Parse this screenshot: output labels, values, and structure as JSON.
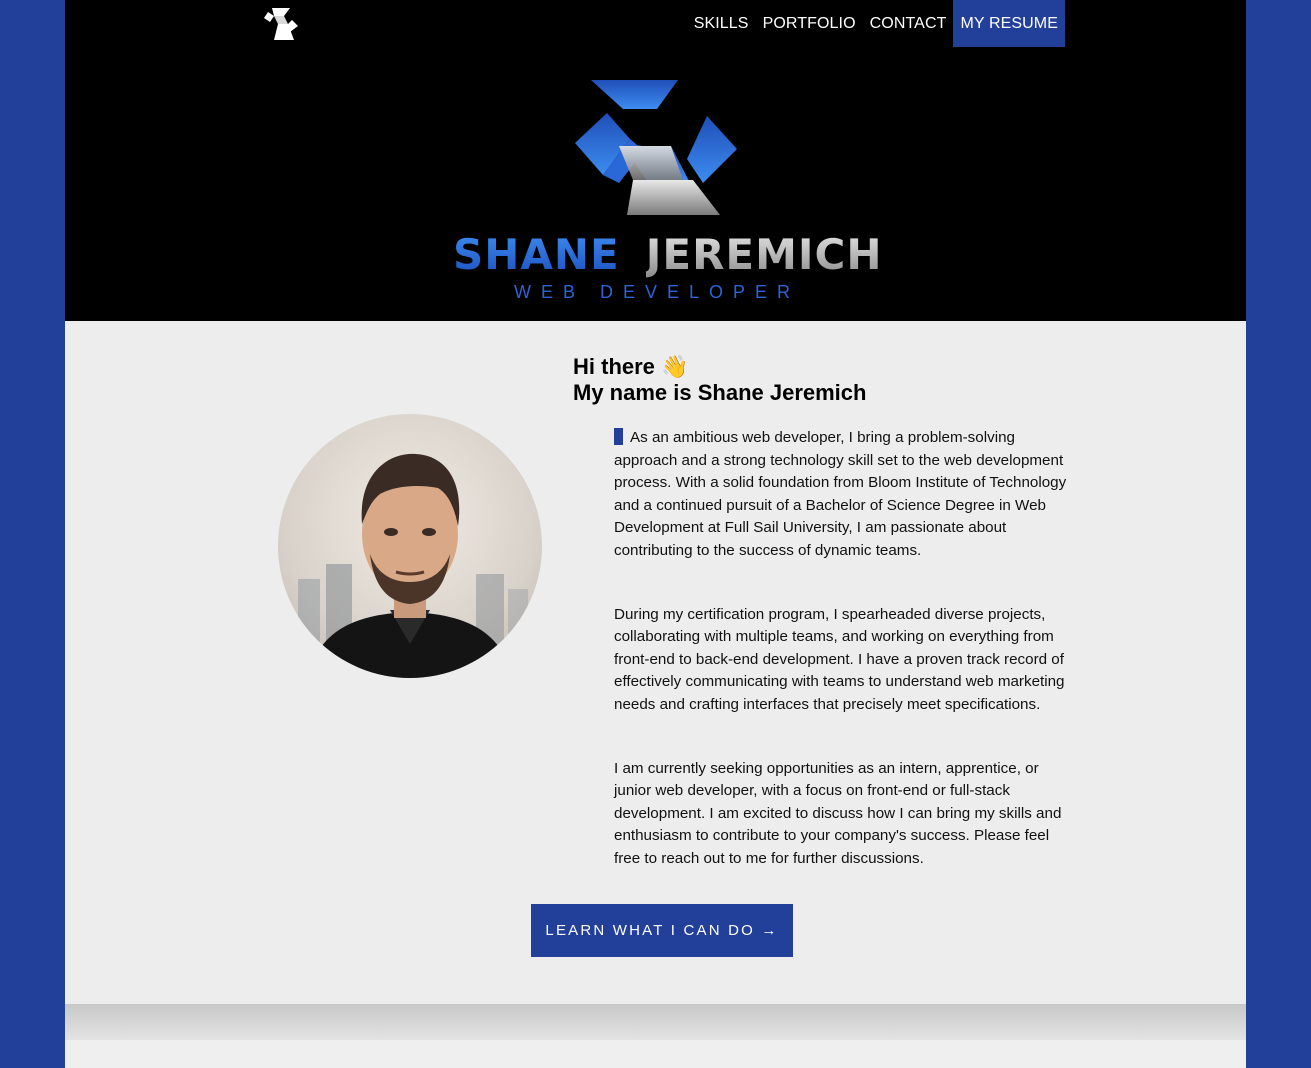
{
  "nav": {
    "logo_icon": "s-monogram-logo-icon",
    "items": [
      {
        "label": "SKILLS"
      },
      {
        "label": "PORTFOLIO"
      },
      {
        "label": "CONTACT"
      },
      {
        "label": "MY RESUME"
      }
    ]
  },
  "hero": {
    "first_name": "SHANE",
    "last_name": "JEREMICH",
    "role": "WEB DEVELOPER"
  },
  "about": {
    "greeting_line1": "Hi there 👋",
    "greeting_line2": "My name is Shane Jeremich",
    "paragraphs": [
      "As an ambitious web developer, I bring a problem-solving approach and a strong technology skill set to the web development process. With a solid foundation from Bloom Institute of Technology and a continued pursuit of a Bachelor of Science Degree in Web Development at Full Sail University, I am passionate about contributing to the success of dynamic teams.",
      "During my certification program, I spearheaded diverse projects, collaborating with multiple teams, and working on everything from front-end to back-end development. I have a proven track record of effectively communicating with teams to understand web marketing needs and crafting interfaces that precisely meet specifications.",
      "I am currently seeking opportunities as an intern, apprentice, or junior web developer, with a focus on front-end or full-stack development. I am excited to discuss how I can bring my skills and enthusiasm to contribute to your company's success. Please feel free to reach out to me for further discussions."
    ],
    "cta_label": "LEARN WHAT I CAN DO →"
  },
  "colors": {
    "accent": "#22409a",
    "header_bg": "#000000",
    "page_bg": "#ededed"
  }
}
